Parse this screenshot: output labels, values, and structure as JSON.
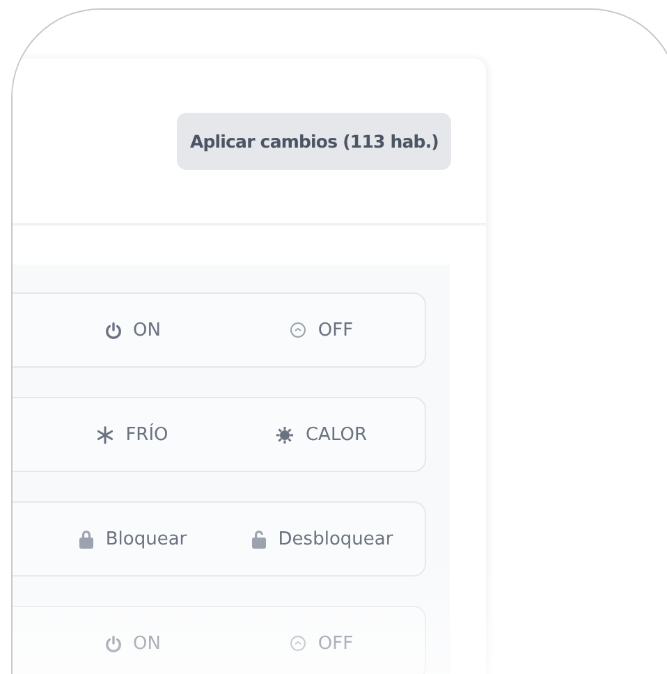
{
  "apply_button": {
    "label": "Aplicar cambios (113 hab.)"
  },
  "groups": [
    {
      "options": [
        {
          "kind": "power",
          "label": "ON"
        },
        {
          "kind": "off",
          "label": "OFF"
        }
      ]
    },
    {
      "options": [
        {
          "kind": "snow",
          "label": "FRÍO"
        },
        {
          "kind": "sun",
          "label": "CALOR"
        }
      ]
    },
    {
      "options": [
        {
          "kind": "lock",
          "label": "Bloquear"
        },
        {
          "kind": "unlock",
          "label": "Desbloquear"
        }
      ]
    },
    {
      "options": [
        {
          "kind": "power",
          "label": "ON"
        },
        {
          "kind": "off",
          "label": "OFF"
        }
      ]
    }
  ]
}
